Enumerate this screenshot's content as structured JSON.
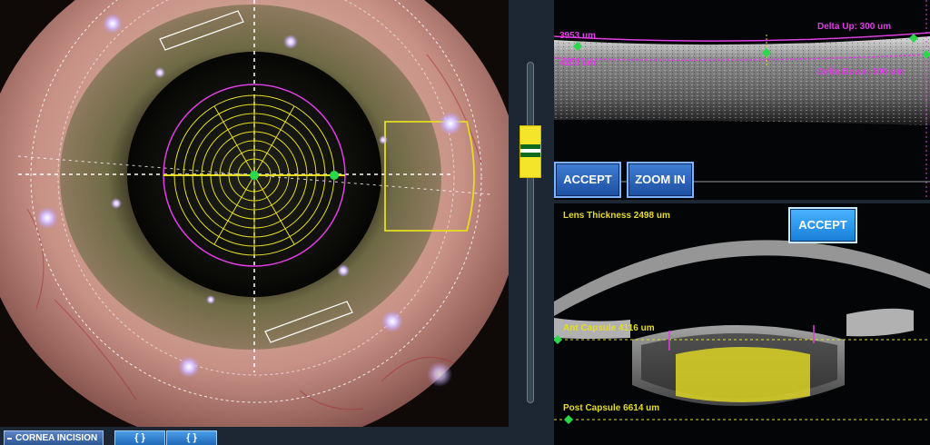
{
  "toolbar": {
    "cornea_incision_label": "CORNEA INCISION",
    "btn_left_label": "{ }",
    "btn_right_label": "{ }"
  },
  "cornea_panel": {
    "accept_label": "ACCEPT",
    "zoom_in_label": "ZOOM IN",
    "anterior_label": "3953 um",
    "posterior_label": "4153 um",
    "delta_up_label": "Delta Up: 300 um",
    "delta_down_label": "Delta Down: 300 um"
  },
  "lens_panel": {
    "accept_label": "ACCEPT",
    "lens_thickness_label": "Lens Thickness 2498 um",
    "ant_capsule_label": "Ant Capsule 4116 um",
    "post_capsule_label": "Post Capsule 6614 um"
  },
  "colors": {
    "overlay_yellow": "#e6dd22",
    "overlay_magenta": "#e13de6",
    "marker_green": "#29d94b",
    "button_blue": "#2d5fb0"
  },
  "icons": [
    "green-center-marker",
    "green-edge-marker",
    "slider-handle"
  ]
}
